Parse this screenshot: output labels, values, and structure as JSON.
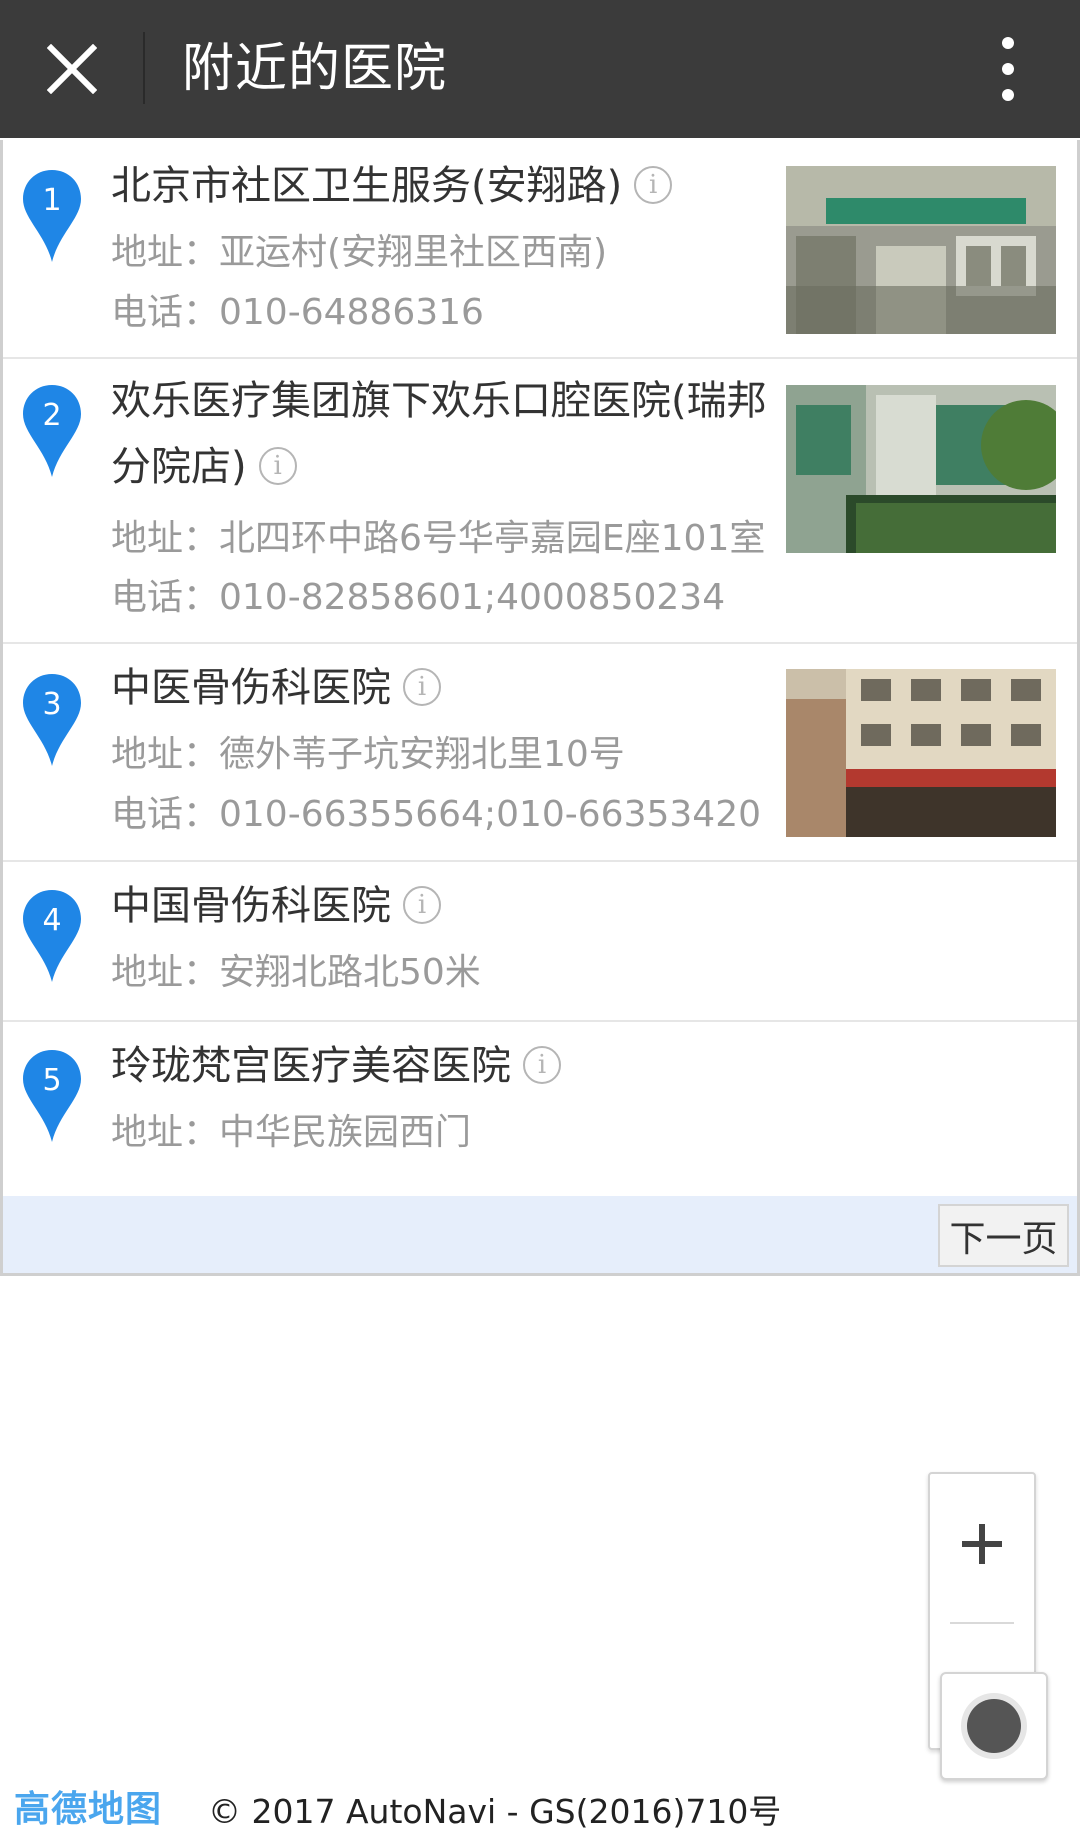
{
  "header": {
    "title": "附近的医院",
    "close_icon": "close-icon",
    "more_icon": "more-vertical-icon"
  },
  "list": [
    {
      "index": "1",
      "name": "北京市社区卫生服务(安翔路)",
      "address": "地址：亚运村(安翔里社区西南)",
      "phone": "电话：010-64886316",
      "has_photo": true
    },
    {
      "index": "2",
      "name": "欢乐医疗集团旗下欢乐口腔医院(瑞邦",
      "name_line2": "分院店)",
      "address": "地址：北四环中路6号华亭嘉园E座101室",
      "phone": "电话：010-82858601;4000850234",
      "has_photo": true
    },
    {
      "index": "3",
      "name": "中医骨伤科医院",
      "address": "地址：德外苇子坑安翔北里10号",
      "phone": "电话：010-66355664;010-66353420",
      "has_photo": true
    },
    {
      "index": "4",
      "name": "中国骨伤科医院",
      "address": "地址：安翔北路北50米"
    },
    {
      "index": "5",
      "name": "玲珑梵宫医疗美容医院",
      "address": "地址：中华民族园西门"
    }
  ],
  "pager": {
    "next_label": "下一页"
  },
  "map": {
    "zoom_in_label": "+",
    "logo_text": "高德地图",
    "copyright": "© 2017 AutoNavi - GS(2016)710号"
  },
  "colors": {
    "header_bg": "#3b3b3b",
    "pin_blue": "#1f86e6",
    "pager_bg": "#e6eefb",
    "logo_blue": "#4aa6ee"
  }
}
